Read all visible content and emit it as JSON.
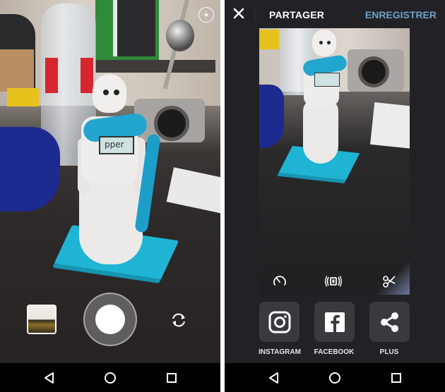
{
  "camera_screen": {
    "viewfinder_label": "Camera preview",
    "flash_icon": "flash-auto-icon",
    "gallery_thumbnail": "last-capture-thumbnail",
    "shutter_icon": "shutter-icon",
    "switch_camera_icon": "switch-camera-icon",
    "scene_tablet_text": "pper"
  },
  "share_screen": {
    "close_icon": "close-icon",
    "title": "PARTAGER",
    "save_label": "ENREGISTRER",
    "save_color": "#6ea0c8",
    "preview_tablet_text": "pper",
    "tools": [
      {
        "icon": "speed-gauge-icon"
      },
      {
        "icon": "stabilize-icon"
      },
      {
        "icon": "trim-scissors-icon"
      }
    ],
    "share_targets": [
      {
        "label": "INSTAGRAM",
        "icon": "instagram-icon"
      },
      {
        "label": "FACEBOOK",
        "icon": "facebook-icon"
      },
      {
        "label": "PLUS",
        "icon": "share-icon"
      }
    ]
  },
  "navbar": {
    "back_icon": "back-icon",
    "home_icon": "home-icon",
    "recents_icon": "recents-icon"
  },
  "colors": {
    "share_background": "#222226",
    "button_background": "#3a3a3e",
    "accent_blue": "#6ea0c8",
    "navbar": "#000000"
  }
}
